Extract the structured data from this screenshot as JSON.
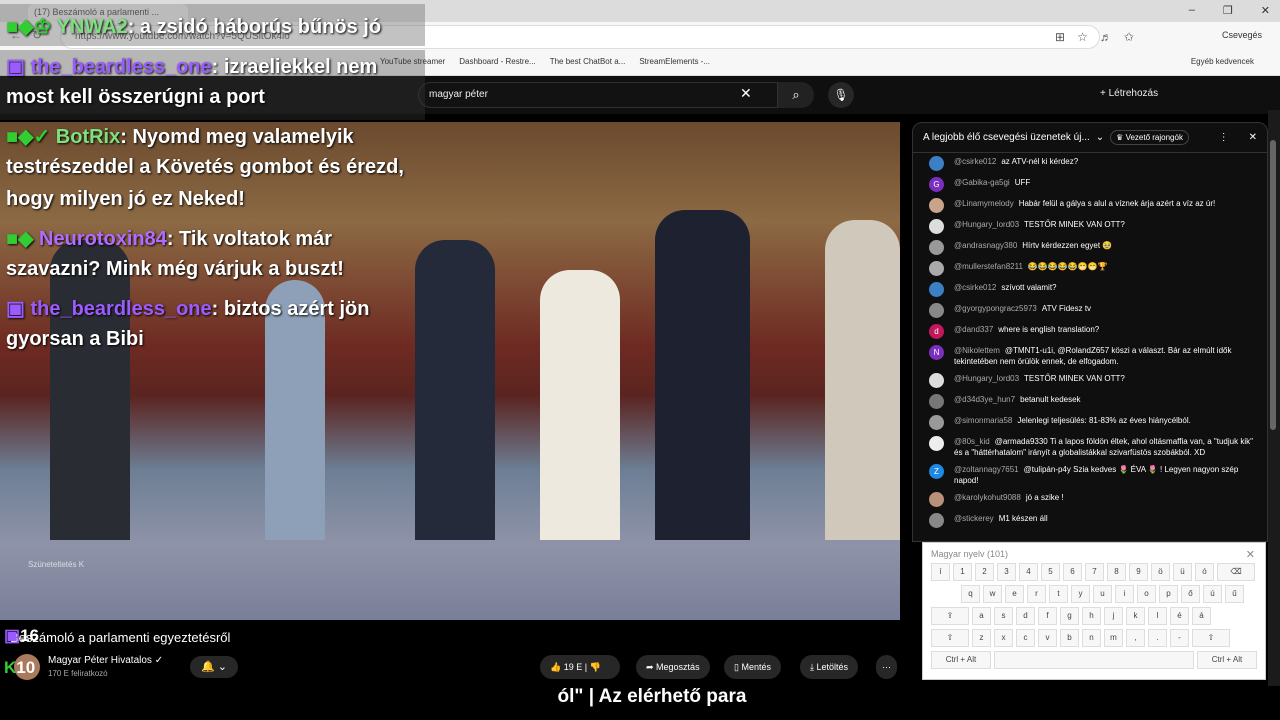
{
  "browser": {
    "tab_title": "(17) Beszámoló a parlamenti ...",
    "url": "https://www.youtube.com/watch?v=5QUSltOk4io",
    "profile": "Csevegés",
    "bookmarks": [
      "YouTube streamer",
      "Dashboard - Restre...",
      "The best ChatBot a...",
      "StreamElements -...",
      "Egyéb kedvencek"
    ]
  },
  "youtube": {
    "search_value": "magyar péter",
    "create_label": "Létrehozás"
  },
  "overlay_chat": [
    {
      "user": "YNWA2",
      "text": ": a zsidó háborús bűnös jó",
      "user_color": "#7fe07f"
    },
    {
      "user": "the_beardless_one",
      "text": ": izraeliekkel nem",
      "user_color": "#9b5cff"
    },
    {
      "text": "most kell összerúgni a port"
    },
    {
      "user": "BotRix",
      "text": ": Nyomd meg valamelyik",
      "user_color": "#7fe07f"
    },
    {
      "text": "testrészeddel a Követés gombot és érezd,"
    },
    {
      "text": "hogy milyen jó ez Neked!"
    },
    {
      "user": "Neurotoxin84",
      "text": ": Tik voltatok már",
      "user_color": "#b06cff"
    },
    {
      "text": "szavazni? Mink még várjuk a buszt!"
    },
    {
      "user": "the_beardless_one",
      "text": ": biztos azért jön",
      "user_color": "#9b5cff"
    },
    {
      "text": "gyorsan a Bibi"
    }
  ],
  "counters": {
    "twitch": "16",
    "kick": "10"
  },
  "video": {
    "stamp": "Szüneteltetés  K",
    "title": "Beszámoló a parlamenti egyeztetésről",
    "channel": "Magyar Péter Hivatalos",
    "subs": "170 E feliratkozó",
    "likes": "19 E",
    "share": "Megosztás",
    "save": "Mentés",
    "download": "Letöltés",
    "more": "···"
  },
  "chat": {
    "header": "A legjobb élő csevegési üzenetek új...",
    "top_fans": "Vezető rajongók",
    "messages": [
      {
        "author": "@csirke012",
        "text": "az ATV-nél ki kérdez?",
        "color": "#3b7fc4"
      },
      {
        "author": "@Gabika-ga5gi",
        "text": "UFF",
        "color": "#7b2fbf",
        "initial": "G"
      },
      {
        "author": "@Linamymelody",
        "text": "Habár felül a gálya s alul a víznek árja azért a víz az úr!",
        "color": "#c9a48a"
      },
      {
        "author": "@Hungary_lord03",
        "text": "TESTŐR MINEK VAN OTT?",
        "color": "#ddd"
      },
      {
        "author": "@andrasnagy380",
        "text": "Hírtv kérdezzen egyet 🥹",
        "color": "#999"
      },
      {
        "author": "@mullerstefan8211",
        "text": "😂😂😂😂😂😁😁🏆",
        "color": "#aaa"
      },
      {
        "author": "@csirke012",
        "text": "szívott valamit?",
        "color": "#3b7fc4"
      },
      {
        "author": "@gyorgypongracz5973",
        "text": "ATV Fidesz tv",
        "color": "#888"
      },
      {
        "author": "@dand337",
        "text": "where is english translation?",
        "color": "#c2185b",
        "initial": "d"
      },
      {
        "author": "@Nikolettem",
        "text": "@TMNT1-u1i, @RolandZ657 köszi a választ. Bár az elmúlt idők tekintetében nem örülök ennek, de elfogadom.",
        "color": "#7b2fbf",
        "initial": "N"
      },
      {
        "author": "@Hungary_lord03",
        "text": "TESTŐR MINEK VAN OTT?",
        "color": "#ddd"
      },
      {
        "author": "@d34d3ye_hun7",
        "text": "betanult kedesek",
        "color": "#777"
      },
      {
        "author": "@simonmaria58",
        "text": "Jelenlegi teljesülés: 81-83% az éves hiánycélból.",
        "color": "#999"
      },
      {
        "author": "@80s_kid",
        "text": "@armada9330 Ti a lapos földön éltek, ahol oltásmaffia van, a \"tudjuk kik\" és a \"háttérhatalom\" irányít a globalistákkal szivarfüstös szobákból. XD",
        "color": "#eee"
      },
      {
        "author": "@zoltannagy7651",
        "text": "@tulipán-p4y Szia kedves 🌷 ÉVA 🌷 ! Legyen nagyon szép napod!",
        "color": "#1e88e5",
        "initial": "Z"
      },
      {
        "author": "@karolykohut9088",
        "text": "jó a szike !",
        "color": "#b9907a"
      },
      {
        "author": "@stickerey",
        "text": "M1 készen áll",
        "color": "#888"
      }
    ]
  },
  "keyboard": {
    "title": "Magyar nyelv (101)",
    "rows": [
      [
        "í",
        "1",
        "2",
        "3",
        "4",
        "5",
        "6",
        "7",
        "8",
        "9",
        "ö",
        "ü",
        "ó",
        "⌫"
      ],
      [
        "q",
        "w",
        "e",
        "r",
        "t",
        "y",
        "u",
        "i",
        "o",
        "p",
        "ő",
        "ú",
        "ű"
      ],
      [
        "⇪",
        "a",
        "s",
        "d",
        "f",
        "g",
        "h",
        "j",
        "k",
        "l",
        "é",
        "á"
      ],
      [
        "⇧",
        "z",
        "x",
        "c",
        "v",
        "b",
        "n",
        "m",
        ",",
        ".",
        "-",
        "⇧"
      ],
      [
        "Ctrl + Alt",
        " ",
        "Ctrl + Alt"
      ]
    ]
  },
  "subtitle": "ól\" | Az elérhető para"
}
